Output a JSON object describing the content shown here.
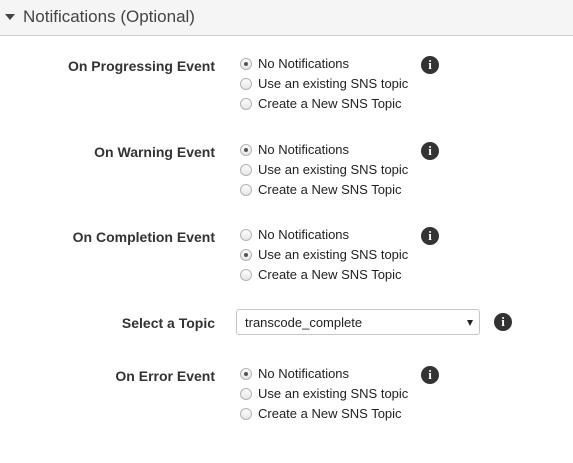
{
  "section": {
    "title": "Notifications (Optional)"
  },
  "options": {
    "no_notifications": "No Notifications",
    "use_existing": "Use an existing SNS topic",
    "create_new": "Create a New SNS Topic"
  },
  "events": [
    {
      "label": "On Progressing Event",
      "selected": "No Notifications"
    },
    {
      "label": "On Warning Event",
      "selected": "No Notifications"
    },
    {
      "label": "On Completion Event",
      "selected": "Use an existing SNS topic"
    },
    {
      "label": "On Error Event",
      "selected": "No Notifications"
    }
  ],
  "topic": {
    "label": "Select a Topic",
    "value": "transcode_complete"
  },
  "icons": {
    "info": "info-icon",
    "collapse": "caret-down-icon",
    "dropdown": "chevron-down-icon"
  },
  "info_glyph": "i"
}
